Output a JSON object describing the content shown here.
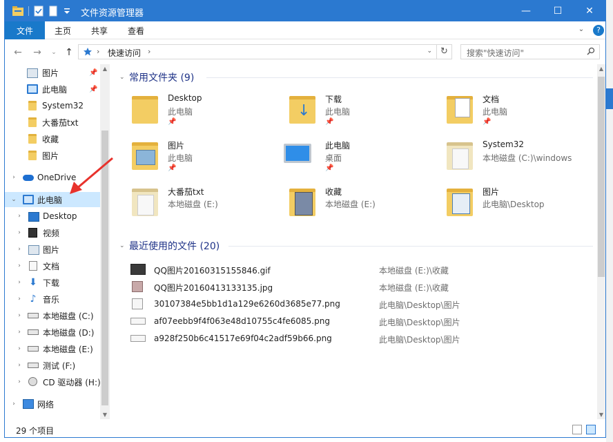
{
  "window": {
    "title": "文件资源管理器",
    "min": "—",
    "max": "☐",
    "close": "✕"
  },
  "ribbon": {
    "file": "文件",
    "home": "主页",
    "share": "共享",
    "view": "查看",
    "expand": "⌄",
    "help": "?"
  },
  "nav": {
    "back": "←",
    "forward": "→",
    "recent": "⌄",
    "up": "↑"
  },
  "address": {
    "crumb": "快速访问",
    "sep": "›",
    "dd": "⌄",
    "refresh": "↻"
  },
  "search": {
    "placeholder": "搜索\"快速访问\"",
    "icon": "⚲"
  },
  "navpane": {
    "items": [
      {
        "label": "图片",
        "pinned": true
      },
      {
        "label": "此电脑",
        "pinned": true
      },
      {
        "label": "System32"
      },
      {
        "label": "大番茄txt"
      },
      {
        "label": "收藏"
      },
      {
        "label": "图片"
      },
      {
        "label": "OneDrive"
      },
      {
        "label": "此电脑"
      },
      {
        "label": "Desktop"
      },
      {
        "label": "视频"
      },
      {
        "label": "图片"
      },
      {
        "label": "文档"
      },
      {
        "label": "下载"
      },
      {
        "label": "音乐"
      },
      {
        "label": "本地磁盘 (C:)"
      },
      {
        "label": "本地磁盘 (D:)"
      },
      {
        "label": "本地磁盘 (E:)"
      },
      {
        "label": "测试 (F:)"
      },
      {
        "label": "CD 驱动器 (H:)"
      },
      {
        "label": "网络"
      }
    ],
    "pin_glyph": "📌",
    "chev_right": "›",
    "chev_down": "⌄"
  },
  "sections": {
    "frequent": {
      "title": "常用文件夹 (9)"
    },
    "recent": {
      "title": "最近使用的文件 (20)"
    }
  },
  "frequent": [
    {
      "name": "Desktop",
      "sub": "此电脑",
      "pin": "📌"
    },
    {
      "name": "下载",
      "sub": "此电脑",
      "pin": "📌"
    },
    {
      "name": "文档",
      "sub": "此电脑",
      "pin": "📌"
    },
    {
      "name": "图片",
      "sub": "此电脑",
      "pin": "📌"
    },
    {
      "name": "此电脑",
      "sub": "桌面",
      "pin": "📌"
    },
    {
      "name": "System32",
      "sub": "本地磁盘 (C:)\\windows"
    },
    {
      "name": "大番茄txt",
      "sub": "本地磁盘 (E:)"
    },
    {
      "name": "收藏",
      "sub": "本地磁盘 (E:)"
    },
    {
      "name": "图片",
      "sub": "此电脑\\Desktop"
    }
  ],
  "recent": [
    {
      "name": "QQ图片20160315155846.gif",
      "path": "本地磁盘 (E:)\\收藏"
    },
    {
      "name": "QQ图片20160413133135.jpg",
      "path": "本地磁盘 (E:)\\收藏"
    },
    {
      "name": "30107384e5bb1d1a129e6260d3685e77.png",
      "path": "此电脑\\Desktop\\图片"
    },
    {
      "name": "af07eebb9f4f063e48d10755c4fe6085.png",
      "path": "此电脑\\Desktop\\图片"
    },
    {
      "name": "a928f250b6c41517e69f04c2adf59b66.png",
      "path": "此电脑\\Desktop\\图片"
    }
  ],
  "status": {
    "count": "29 个项目"
  },
  "colors": {
    "accent": "#2b79d0",
    "selected": "#cce8ff",
    "section_title": "#1e3287",
    "arrow": "#e8322c"
  }
}
